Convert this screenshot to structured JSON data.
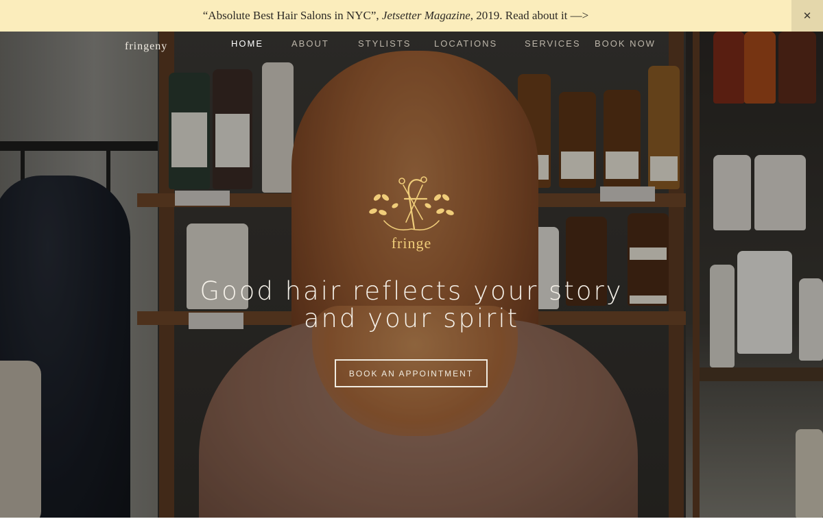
{
  "banner": {
    "quote": "“Absolute Best Hair Salons in NYC”, ",
    "publication": "Jetsetter Magazine",
    "rest": ", 2019. Read about it —>",
    "close": "✕"
  },
  "header": {
    "brand": "fringeny",
    "nav": [
      "HOME",
      "ABOUT",
      "STYLISTS",
      "LOCATIONS",
      "SERVICES",
      "BOOK NOW"
    ],
    "active": "HOME"
  },
  "hero": {
    "logo_word": "fringe",
    "headline_line1": "Good hair reflects your story",
    "headline_line2": "and your spirit",
    "cta": "BOOK AN APPOINTMENT"
  },
  "colors": {
    "banner_bg": "#fbedbc",
    "logo_gold": "#f0cd7a",
    "text_light": "#f6f2ea"
  },
  "icons": {
    "logo": "fringe-scissors-leaf-emblem",
    "close": "close-icon"
  }
}
